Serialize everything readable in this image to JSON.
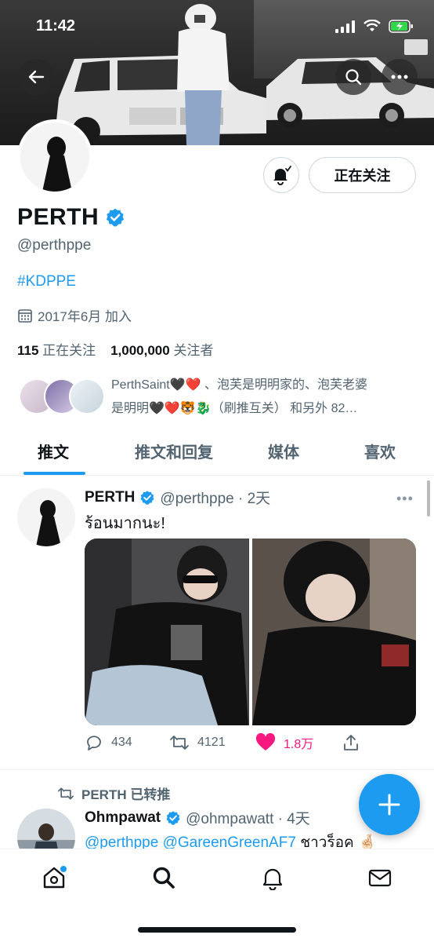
{
  "status_bar": {
    "time": "11:42"
  },
  "profile": {
    "name": "PERTH",
    "handle": "@perthppe",
    "bio_tag": "#KDPPE",
    "joined": "2017年6月 加入",
    "following_count": "115",
    "following_label": "正在关注",
    "followers_count": "1,000,000",
    "followers_label": "关注者",
    "follow_button": "正在关注",
    "followed_by_line1": "PerthSaint🖤❤️ 、泡芙是明明家的、泡芙老婆",
    "followed_by_line2": "是明明🖤❤️🐯🐉（刷推互关） 和另外 82…"
  },
  "tabs": [
    {
      "label": "推文"
    },
    {
      "label": "推文和回复"
    },
    {
      "label": "媒体"
    },
    {
      "label": "喜欢"
    }
  ],
  "tweet1": {
    "name": "PERTH",
    "handle_time": "@perthppe · 2天",
    "text": "ร้อนมากนะ!",
    "replies": "434",
    "retweets": "4121",
    "likes": "1.8万",
    "like_color": "#f91880"
  },
  "tweet2": {
    "retweeted_by": "PERTH 已转推",
    "name": "Ohmpawat",
    "handle_time": "@ohmpawatt · 4天",
    "mention1": "@perthppe",
    "mention2": "@GareenGreenAF7",
    "text": "ชาวร็อค 🤞🏻"
  },
  "colors": {
    "accent": "#1d9bf0",
    "text": "#0f1419",
    "muted": "#536471"
  }
}
